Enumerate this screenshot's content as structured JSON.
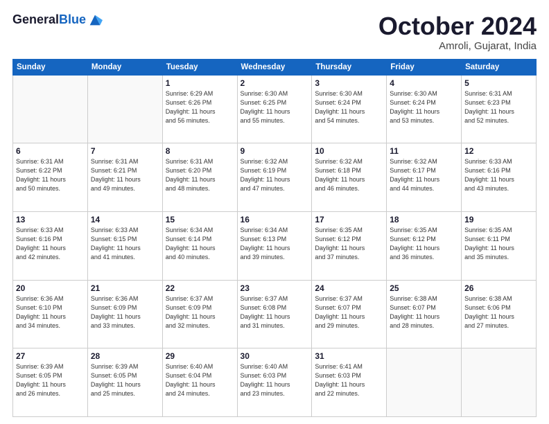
{
  "logo": {
    "line1": "General",
    "line2": "Blue"
  },
  "title": "October 2024",
  "location": "Amroli, Gujarat, India",
  "weekdays": [
    "Sunday",
    "Monday",
    "Tuesday",
    "Wednesday",
    "Thursday",
    "Friday",
    "Saturday"
  ],
  "weeks": [
    [
      {
        "day": "",
        "info": ""
      },
      {
        "day": "",
        "info": ""
      },
      {
        "day": "1",
        "info": "Sunrise: 6:29 AM\nSunset: 6:26 PM\nDaylight: 11 hours\nand 56 minutes."
      },
      {
        "day": "2",
        "info": "Sunrise: 6:30 AM\nSunset: 6:25 PM\nDaylight: 11 hours\nand 55 minutes."
      },
      {
        "day": "3",
        "info": "Sunrise: 6:30 AM\nSunset: 6:24 PM\nDaylight: 11 hours\nand 54 minutes."
      },
      {
        "day": "4",
        "info": "Sunrise: 6:30 AM\nSunset: 6:24 PM\nDaylight: 11 hours\nand 53 minutes."
      },
      {
        "day": "5",
        "info": "Sunrise: 6:31 AM\nSunset: 6:23 PM\nDaylight: 11 hours\nand 52 minutes."
      }
    ],
    [
      {
        "day": "6",
        "info": "Sunrise: 6:31 AM\nSunset: 6:22 PM\nDaylight: 11 hours\nand 50 minutes."
      },
      {
        "day": "7",
        "info": "Sunrise: 6:31 AM\nSunset: 6:21 PM\nDaylight: 11 hours\nand 49 minutes."
      },
      {
        "day": "8",
        "info": "Sunrise: 6:31 AM\nSunset: 6:20 PM\nDaylight: 11 hours\nand 48 minutes."
      },
      {
        "day": "9",
        "info": "Sunrise: 6:32 AM\nSunset: 6:19 PM\nDaylight: 11 hours\nand 47 minutes."
      },
      {
        "day": "10",
        "info": "Sunrise: 6:32 AM\nSunset: 6:18 PM\nDaylight: 11 hours\nand 46 minutes."
      },
      {
        "day": "11",
        "info": "Sunrise: 6:32 AM\nSunset: 6:17 PM\nDaylight: 11 hours\nand 44 minutes."
      },
      {
        "day": "12",
        "info": "Sunrise: 6:33 AM\nSunset: 6:16 PM\nDaylight: 11 hours\nand 43 minutes."
      }
    ],
    [
      {
        "day": "13",
        "info": "Sunrise: 6:33 AM\nSunset: 6:16 PM\nDaylight: 11 hours\nand 42 minutes."
      },
      {
        "day": "14",
        "info": "Sunrise: 6:33 AM\nSunset: 6:15 PM\nDaylight: 11 hours\nand 41 minutes."
      },
      {
        "day": "15",
        "info": "Sunrise: 6:34 AM\nSunset: 6:14 PM\nDaylight: 11 hours\nand 40 minutes."
      },
      {
        "day": "16",
        "info": "Sunrise: 6:34 AM\nSunset: 6:13 PM\nDaylight: 11 hours\nand 39 minutes."
      },
      {
        "day": "17",
        "info": "Sunrise: 6:35 AM\nSunset: 6:12 PM\nDaylight: 11 hours\nand 37 minutes."
      },
      {
        "day": "18",
        "info": "Sunrise: 6:35 AM\nSunset: 6:12 PM\nDaylight: 11 hours\nand 36 minutes."
      },
      {
        "day": "19",
        "info": "Sunrise: 6:35 AM\nSunset: 6:11 PM\nDaylight: 11 hours\nand 35 minutes."
      }
    ],
    [
      {
        "day": "20",
        "info": "Sunrise: 6:36 AM\nSunset: 6:10 PM\nDaylight: 11 hours\nand 34 minutes."
      },
      {
        "day": "21",
        "info": "Sunrise: 6:36 AM\nSunset: 6:09 PM\nDaylight: 11 hours\nand 33 minutes."
      },
      {
        "day": "22",
        "info": "Sunrise: 6:37 AM\nSunset: 6:09 PM\nDaylight: 11 hours\nand 32 minutes."
      },
      {
        "day": "23",
        "info": "Sunrise: 6:37 AM\nSunset: 6:08 PM\nDaylight: 11 hours\nand 31 minutes."
      },
      {
        "day": "24",
        "info": "Sunrise: 6:37 AM\nSunset: 6:07 PM\nDaylight: 11 hours\nand 29 minutes."
      },
      {
        "day": "25",
        "info": "Sunrise: 6:38 AM\nSunset: 6:07 PM\nDaylight: 11 hours\nand 28 minutes."
      },
      {
        "day": "26",
        "info": "Sunrise: 6:38 AM\nSunset: 6:06 PM\nDaylight: 11 hours\nand 27 minutes."
      }
    ],
    [
      {
        "day": "27",
        "info": "Sunrise: 6:39 AM\nSunset: 6:05 PM\nDaylight: 11 hours\nand 26 minutes."
      },
      {
        "day": "28",
        "info": "Sunrise: 6:39 AM\nSunset: 6:05 PM\nDaylight: 11 hours\nand 25 minutes."
      },
      {
        "day": "29",
        "info": "Sunrise: 6:40 AM\nSunset: 6:04 PM\nDaylight: 11 hours\nand 24 minutes."
      },
      {
        "day": "30",
        "info": "Sunrise: 6:40 AM\nSunset: 6:03 PM\nDaylight: 11 hours\nand 23 minutes."
      },
      {
        "day": "31",
        "info": "Sunrise: 6:41 AM\nSunset: 6:03 PM\nDaylight: 11 hours\nand 22 minutes."
      },
      {
        "day": "",
        "info": ""
      },
      {
        "day": "",
        "info": ""
      }
    ]
  ]
}
